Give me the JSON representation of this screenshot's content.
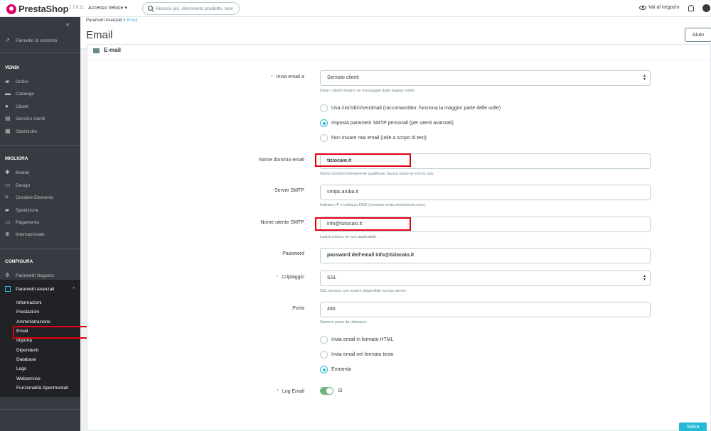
{
  "topbar": {
    "logo_text": "PrestaShop",
    "version": "1.7.8.11",
    "quick_access": "Accesso Veloce ▾",
    "search_placeholder": "Ricerca (es. riferimento prodotto, nom",
    "shop_link": "Vai al negozio"
  },
  "sidebar": {
    "dashboard": "Pannello di controllo",
    "sections": {
      "vendi": "VENDI",
      "migliora": "MIGLIORA",
      "configura": "CONFIGURA"
    },
    "vendi_items": [
      "Ordini",
      "Catalogo",
      "Clienti",
      "Servizio clienti",
      "Statistiche"
    ],
    "migliora_items": [
      "Moduli",
      "Design",
      "Creative Elements",
      "Spedizione",
      "Pagamento",
      "Internazionale"
    ],
    "configura_items": [
      "Parametri Negozio",
      "Parametri Avanzati"
    ],
    "sub_items": [
      "Informazioni",
      "Prestazioni",
      "Amministrazione",
      "Email",
      "Importa",
      "Dipendenti",
      "Database",
      "Logs",
      "Webservice",
      "Funzionalità Sperimentali"
    ]
  },
  "header": {
    "breadcrumb_parent": "Parametri Avanzati",
    "breadcrumb_sep": ">",
    "breadcrumb_current": "Email",
    "title": "Email",
    "help_button": "Aiuto"
  },
  "panel": {
    "title": "E-mail",
    "send_to_label": "Invia email a",
    "send_to_value": "Servizio clienti",
    "send_to_help": "Dove i clienti inviano un messaggio dalla pagina ordini.",
    "method_options": [
      "Usa /usr/sbin/sendmail (raccomandato: funziona la maggior parte delle volte)",
      "Imposta parametri SMTP personali (per utenti avanzati)",
      "Non inviare mai email (utile a scopo di test)"
    ],
    "domain_label": "Nome dominio email",
    "domain_value": "tiziocaio.it",
    "domain_help": "Nome dominio interamente qualificato (lascia vuoto se non lo sai).",
    "server_label": "Server SMTP",
    "server_value": "smtps.aruba.it",
    "server_help": "Indirizzo IP o indirizzo DNS (esempio smtp.miodominio.com).",
    "user_label": "Nome utente SMTP",
    "user_value": "info@tiziocaio.it",
    "user_help": "Lascia bianco se non applicabile.",
    "password_label": "Password",
    "password_value": "password dell'email info@tiziocaio.it",
    "crypto_label": "Criptaggio",
    "crypto_value": "SSL",
    "crypto_help": "SSL sembra non essere disponibile sul tuo server.",
    "port_label": "Porta",
    "port_value": "465",
    "port_help": "Numero porta da utilizzare.",
    "format_options": [
      "Invia email in formato HTML",
      "Invia email nel formato testo",
      "Entrambi"
    ],
    "log_label": "Log Email",
    "log_value": "Sì",
    "save_button": "Salva"
  }
}
